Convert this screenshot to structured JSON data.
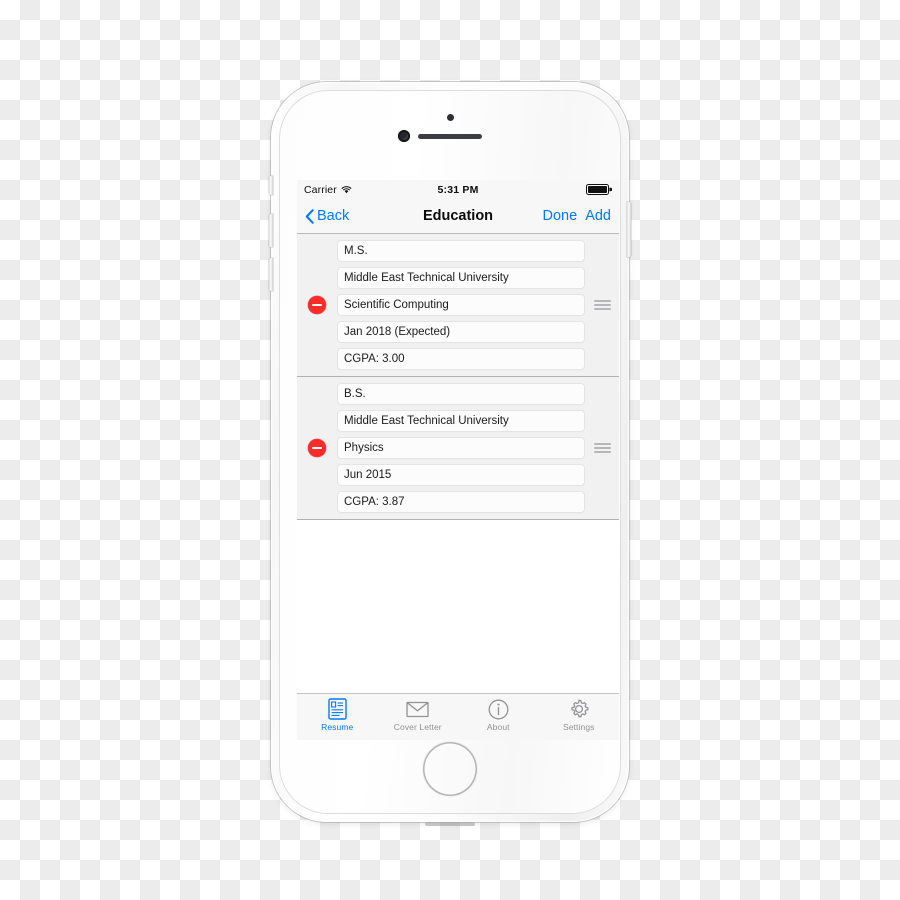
{
  "device": {
    "name": "iphone-white-silver",
    "hardware": {
      "earpiece": "earpiece-speaker",
      "front_camera": "front-camera",
      "proximity_sensor": "proximity-sensor",
      "home_button": "home-button",
      "silent_switch": "silent-switch",
      "volume_up": "volume-up",
      "volume_down": "volume-down",
      "power_button": "power-button"
    }
  },
  "status_bar": {
    "carrier": "Carrier",
    "wifi_icon": "wifi-icon",
    "time": "5:31 PM",
    "battery_icon": "battery-full-icon"
  },
  "nav_bar": {
    "back_label": "Back",
    "back_icon": "chevron-left-icon",
    "title": "Education",
    "done_label": "Done",
    "add_label": "Add",
    "tint_color": "#007aff"
  },
  "education": {
    "delete_icon": "minus-circle-icon",
    "reorder_icon": "reorder-handle-icon",
    "entries": [
      {
        "degree": "M.S.",
        "school": "Middle East Technical University",
        "field": "Scientific Computing",
        "date": "Jan 2018 (Expected)",
        "gpa": "CGPA: 3.00"
      },
      {
        "degree": "B.S.",
        "school": "Middle East Technical University",
        "field": "Physics",
        "date": "Jun 2015",
        "gpa": "CGPA: 3.87"
      }
    ]
  },
  "tab_bar": {
    "selected_index": 0,
    "selected_color": "#007aff",
    "inactive_color": "#929296",
    "items": [
      {
        "label": "Resume",
        "icon": "resume-document-icon"
      },
      {
        "label": "Cover Letter",
        "icon": "envelope-icon"
      },
      {
        "label": "About",
        "icon": "info-circle-icon"
      },
      {
        "label": "Settings",
        "icon": "gear-icon"
      }
    ]
  }
}
